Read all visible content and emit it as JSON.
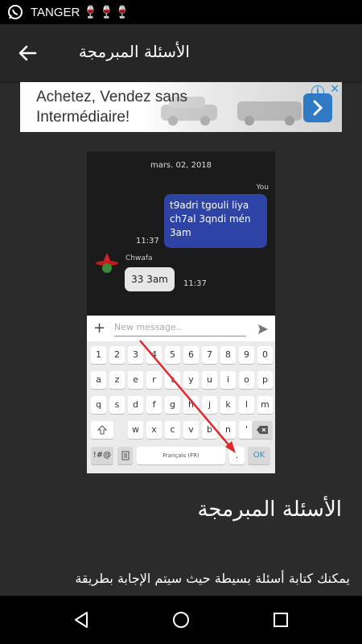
{
  "status_bar": {
    "title": "TANGER",
    "emoji": "🍷🍷🍷"
  },
  "app_bar": {
    "title": "الأسئلة المبرمجة"
  },
  "ad": {
    "text_line1": "Achetez, Vendez sans",
    "text_line2": "Intermédiaire!",
    "info_glyph": "i",
    "close_glyph": "✕"
  },
  "chat": {
    "date": "mars. 02, 2018",
    "you_label": "You",
    "my_message_lines": [
      "t9adri tgouli liya",
      "ch7al 3qndi mén",
      "3am"
    ],
    "my_time": "11:37",
    "sender_name": "Chwafa",
    "their_message": "33 3am",
    "their_time": "11:37",
    "composer_placeholder": "New message.."
  },
  "keyboard": {
    "row1": [
      "1",
      "2",
      "3",
      "4",
      "5",
      "6",
      "7",
      "8",
      "9",
      "0"
    ],
    "row2": [
      "a",
      "z",
      "e",
      "r",
      "t",
      "y",
      "u",
      "i",
      "o",
      "p"
    ],
    "row3": [
      "q",
      "s",
      "d",
      "f",
      "g",
      "h",
      "j",
      "k",
      "l",
      "m"
    ],
    "row4": [
      "w",
      "x",
      "c",
      "v",
      "b",
      "n",
      "'"
    ],
    "sym_key": "!#@",
    "space_label": "Français (FR)",
    "period_key": ".",
    "ok_key": "OK"
  },
  "content": {
    "heading": "الأسئلة المبرمجة",
    "paragraph_line1": "يمكنك كتابة أسئلة بسيطة حيث سيتم الإجابة بطريقة"
  },
  "colors": {
    "annotation_arrow": "#e3262b",
    "my_bubble": "#2d44a6",
    "accent": "#48a7d8"
  }
}
